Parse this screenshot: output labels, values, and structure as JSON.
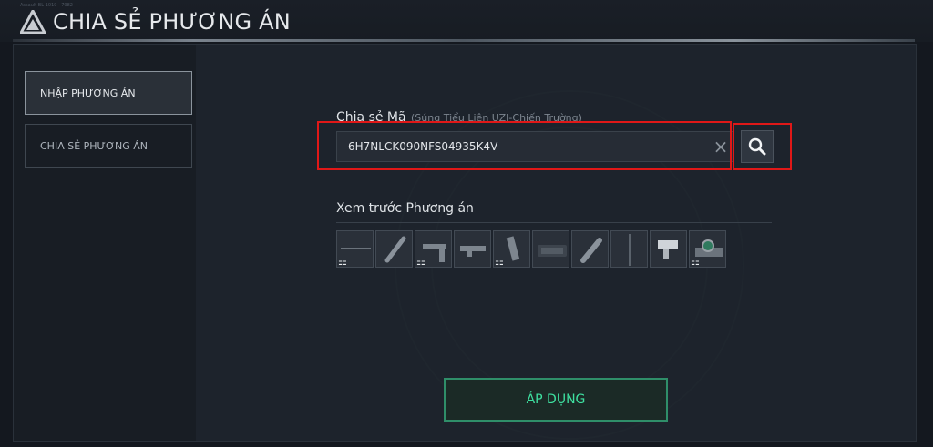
{
  "header": {
    "title": "CHIA SẺ PHƯƠNG ÁN",
    "tiny_text": "Assault BL-1019 · 7982",
    "logo_icon": "tri-logo-icon"
  },
  "sidebar": {
    "items": [
      {
        "label": "NHẬP PHƯƠNG ÁN",
        "active": true
      },
      {
        "label": "CHIA SẺ PHƯƠNG ÁN",
        "active": false
      }
    ]
  },
  "share_code": {
    "label": "Chia sẻ Mã",
    "sublabel": "(Súng Tiểu Liên UZI-Chiến Trường)",
    "value": "6H7NLCK090NFS04935K4V",
    "clear_icon": "close-icon",
    "search_icon": "search-icon"
  },
  "preview": {
    "title": "Xem trước Phương án",
    "slots": [
      {
        "name": "barrel",
        "icon": "barrel-icon",
        "mod": "⚏"
      },
      {
        "name": "suppressor",
        "icon": "suppressor-icon",
        "mod": ""
      },
      {
        "name": "stock",
        "icon": "stock-icon",
        "mod": "⚏"
      },
      {
        "name": "underbarrel",
        "icon": "underbarrel-icon",
        "mod": ""
      },
      {
        "name": "grip",
        "icon": "grip-icon",
        "mod": "⚏"
      },
      {
        "name": "scope",
        "icon": "scope-icon",
        "mod": ""
      },
      {
        "name": "magazine",
        "icon": "magazine-icon",
        "mod": ""
      },
      {
        "name": "rail",
        "icon": "rail-icon",
        "mod": ""
      },
      {
        "name": "laser",
        "icon": "laser-icon",
        "mod": ""
      },
      {
        "name": "sight",
        "icon": "sight-icon",
        "mod": "⚏"
      }
    ]
  },
  "apply_button": {
    "label": "ÁP DỤNG"
  },
  "colors": {
    "accent": "#3ee0a0",
    "highlight": "#e01818",
    "background": "#14181f"
  }
}
